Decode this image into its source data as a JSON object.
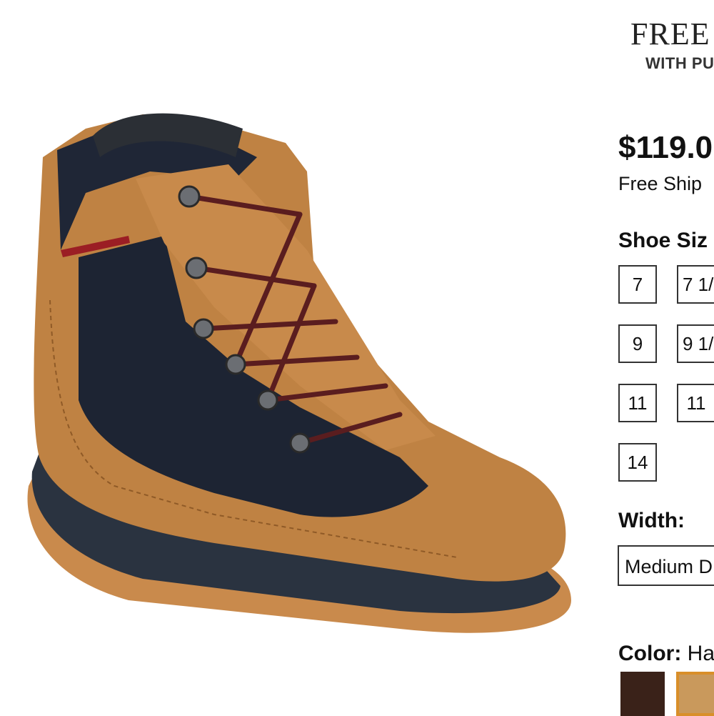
{
  "promo": {
    "title": "FREE",
    "subtitle": "WITH PU"
  },
  "product": {
    "image_alt": "brown leather and navy hiking boot",
    "price": "$119.0",
    "shipping": "Free Ship"
  },
  "size_section": {
    "label": "Shoe Siz",
    "sizes": [
      "7",
      "7 1/",
      "9",
      "9 1/",
      "11",
      "11",
      "14"
    ]
  },
  "width_section": {
    "label": "Width:",
    "selected": "Medium D"
  },
  "color_section": {
    "label": "Color:",
    "selected": "Ha",
    "swatches": [
      {
        "name": "dark-brown",
        "color": "#3a2219"
      },
      {
        "name": "tan",
        "color": "#c9995c",
        "selected": true,
        "border": "#d98f2a"
      }
    ]
  }
}
